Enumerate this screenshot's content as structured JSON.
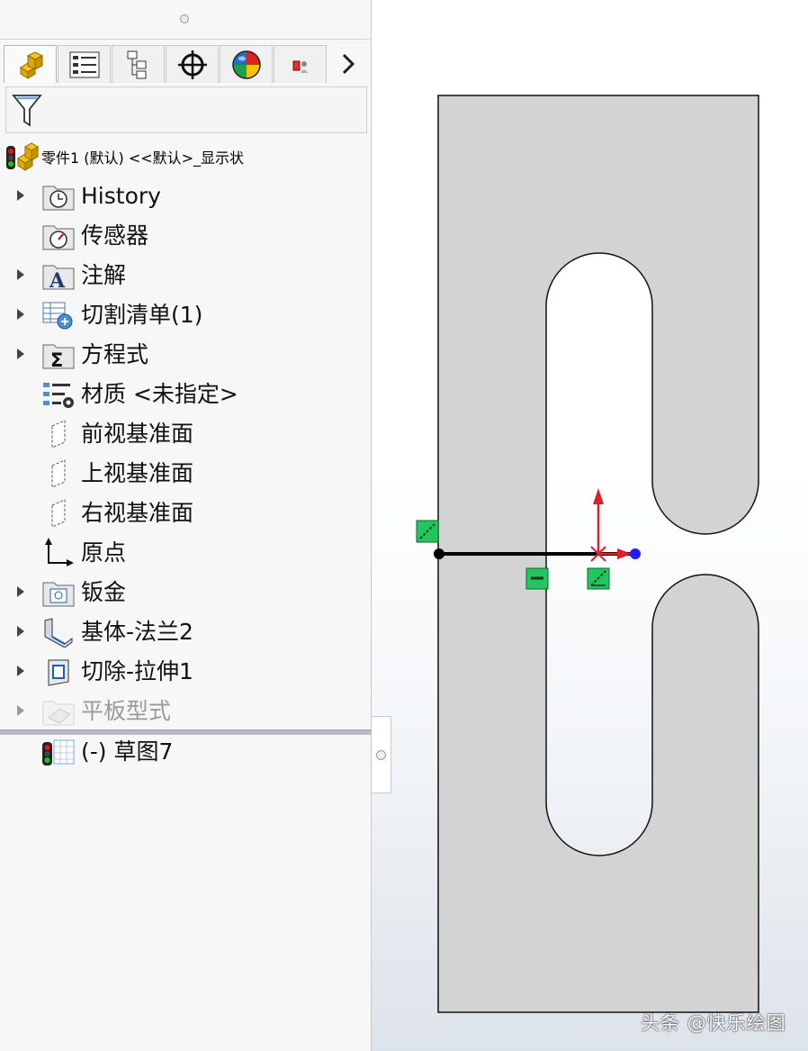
{
  "tabs": [
    {
      "name": "feature-manager-tab",
      "icon": "part-tree-icon"
    },
    {
      "name": "property-manager-tab",
      "icon": "property-list-icon"
    },
    {
      "name": "configuration-manager-tab",
      "icon": "configuration-icon"
    },
    {
      "name": "dimxpert-tab",
      "icon": "crosshair-icon"
    },
    {
      "name": "display-manager-tab",
      "icon": "appearance-sphere-icon"
    },
    {
      "name": "cam-tab",
      "icon": "cam-icon"
    }
  ],
  "tree": {
    "root_label": "零件1 (默认) <<默认>_显示状",
    "items": [
      {
        "label": "History",
        "icon": "history-folder-icon",
        "expandable": true
      },
      {
        "label": "传感器",
        "icon": "sensor-folder-icon",
        "expandable": false
      },
      {
        "label": "注解",
        "icon": "annotation-folder-icon",
        "expandable": true
      },
      {
        "label": "切割清单(1)",
        "icon": "cut-list-icon",
        "expandable": true
      },
      {
        "label": "方程式",
        "icon": "equation-folder-icon",
        "expandable": true
      },
      {
        "label": "材质 <未指定>",
        "icon": "material-icon",
        "expandable": false
      },
      {
        "label": "前视基准面",
        "icon": "plane-icon",
        "expandable": false
      },
      {
        "label": "上视基准面",
        "icon": "plane-icon",
        "expandable": false
      },
      {
        "label": "右视基准面",
        "icon": "plane-icon",
        "expandable": false
      },
      {
        "label": "原点",
        "icon": "origin-icon",
        "expandable": false
      },
      {
        "label": "钣金",
        "icon": "sheet-metal-folder-icon",
        "expandable": true
      },
      {
        "label": "基体-法兰2",
        "icon": "base-flange-icon",
        "expandable": true
      },
      {
        "label": "切除-拉伸1",
        "icon": "cut-extrude-icon",
        "expandable": true
      },
      {
        "label": "平板型式",
        "icon": "flat-pattern-icon",
        "expandable": true,
        "suppressed": true
      }
    ],
    "after_rollback": {
      "label": "(-) 草图7",
      "icon": "sketch-icon"
    }
  },
  "colors": {
    "part_fill": "#d3d3d3",
    "relation_badge": "#22c55e",
    "axis_red": "#e11d2a",
    "point_blue": "#1d1dff"
  },
  "watermark": "头条 @快乐绘图"
}
